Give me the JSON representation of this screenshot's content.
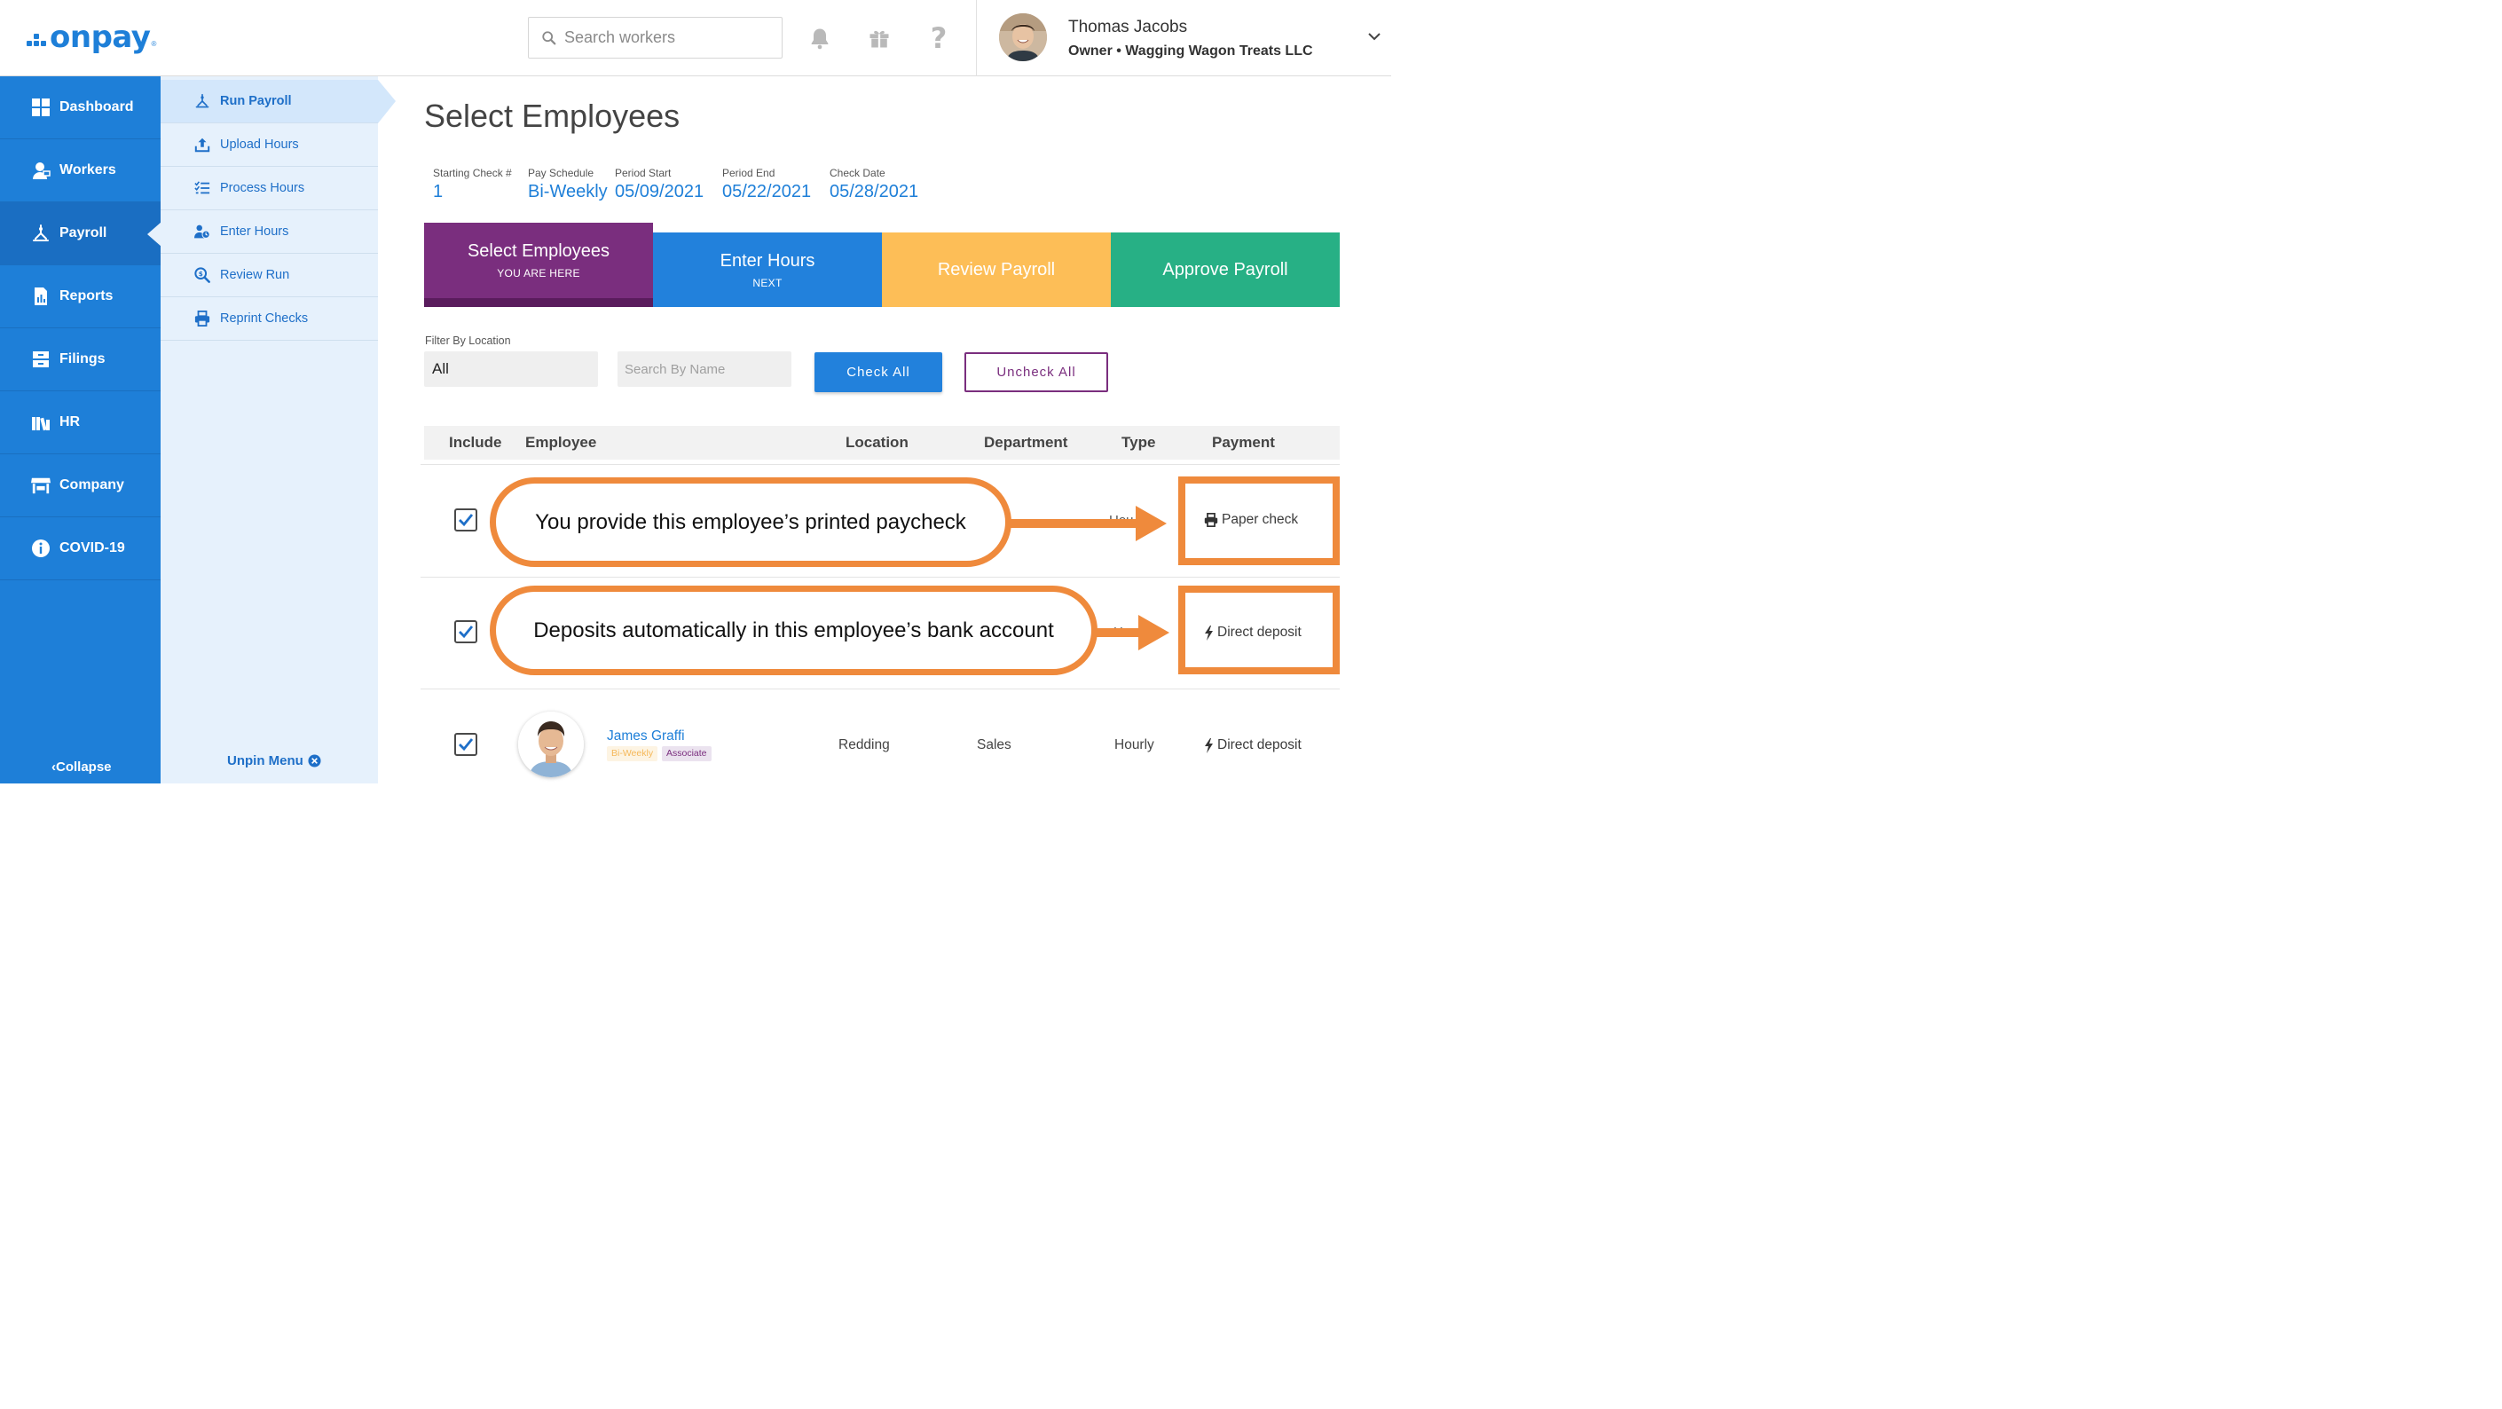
{
  "brand": {
    "logo_text": "onpay",
    "logo_mark": "®",
    "color": "#1e7fd8"
  },
  "header": {
    "search_placeholder": "Search workers",
    "icons": [
      "bell-icon",
      "gift-icon",
      "help-icon"
    ],
    "help_glyph": "?",
    "user_name": "Thomas Jacobs",
    "user_role": "Owner • Wagging Wagon Treats LLC"
  },
  "sidebar": {
    "items": [
      {
        "label": "Dashboard",
        "icon": "dashboard-icon"
      },
      {
        "label": "Workers",
        "icon": "workers-icon"
      },
      {
        "label": "Payroll",
        "icon": "payroll-icon",
        "active": true
      },
      {
        "label": "Reports",
        "icon": "reports-icon"
      },
      {
        "label": "Filings",
        "icon": "filings-icon"
      },
      {
        "label": "HR",
        "icon": "hr-icon"
      },
      {
        "label": "Company",
        "icon": "company-icon"
      },
      {
        "label": "COVID-19",
        "icon": "info-icon"
      }
    ],
    "collapse_label": "Collapse",
    "collapse_glyph": "‹"
  },
  "subnav": {
    "items": [
      {
        "label": "Run Payroll",
        "active": true
      },
      {
        "label": "Upload Hours"
      },
      {
        "label": "Process Hours"
      },
      {
        "label": "Enter Hours"
      },
      {
        "label": "Review Run"
      },
      {
        "label": "Reprint Checks"
      }
    ],
    "unpin_label": "Unpin Menu"
  },
  "main": {
    "title": "Select Employees",
    "meta": [
      {
        "label": "Starting Check #",
        "value": "1"
      },
      {
        "label": "Pay Schedule",
        "value": "Bi-Weekly"
      },
      {
        "label": "Period Start",
        "value": "05/09/2021"
      },
      {
        "label": "Period End",
        "value": "05/22/2021"
      },
      {
        "label": "Check Date",
        "value": "05/28/2021"
      }
    ],
    "steps": [
      {
        "name": "Select Employees",
        "sub": "YOU ARE HERE",
        "color": "#7a2e7e"
      },
      {
        "name": "Enter Hours",
        "sub": "NEXT",
        "color": "#2281dc"
      },
      {
        "name": "Review Payroll",
        "sub": "",
        "color": "#fdbe57"
      },
      {
        "name": "Approve Payroll",
        "sub": "",
        "color": "#27b085"
      }
    ],
    "filter": {
      "location_label": "Filter By Location",
      "location_value": "All",
      "name_placeholder": "Search By Name",
      "check_all": "Check All",
      "uncheck_all": "Uncheck All"
    },
    "table": {
      "headers": [
        "Include",
        "Employee",
        "Location",
        "Department",
        "Type",
        "Payment"
      ],
      "rows": [
        {
          "checked": true,
          "payment": "Paper check",
          "obscured_type": "Hou"
        },
        {
          "checked": true,
          "payment": "Direct deposit",
          "obscured_type": "Hou"
        },
        {
          "checked": true,
          "name": "James Graffi",
          "tags": [
            "Bi-Weekly",
            "Associate"
          ],
          "location": "Redding",
          "department": "Sales",
          "type": "Hourly",
          "payment": "Direct deposit"
        }
      ]
    }
  },
  "annotations": {
    "callout_1": "You provide this employee’s printed paycheck",
    "callout_2": "Deposits automatically in this employee’s bank account",
    "color": "#ef8a3c"
  }
}
